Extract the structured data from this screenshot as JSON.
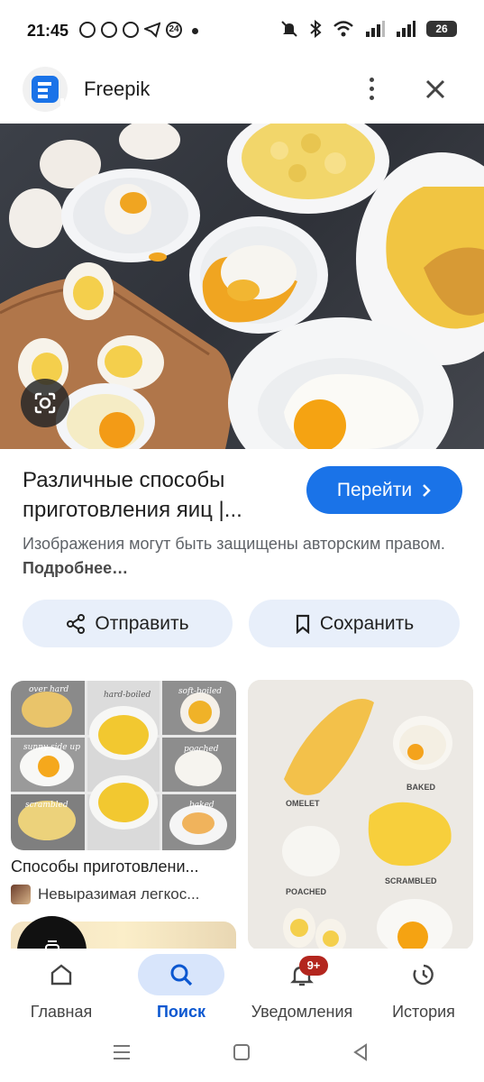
{
  "status_bar": {
    "time": "21:45",
    "notification_icons": [
      "viber-icon",
      "messages-icon",
      "whatsapp-icon",
      "telegram-icon",
      "24-icon"
    ],
    "battery": "26"
  },
  "header": {
    "site_name": "Freepik"
  },
  "result": {
    "title": "Различные способы приготовления яиц |...",
    "go_label": "Перейти",
    "notice_text": "Изображения могут быть защищены авторским правом.",
    "notice_link": "Подробнее…",
    "share_label": "Отправить",
    "save_label": "Сохранить"
  },
  "related": {
    "card_a": {
      "title": "Способы приготовлени...",
      "source": "Невыразимая легкос...",
      "labels": [
        "over hard",
        "hard-boiled",
        "soft-boiled",
        "sunny side up",
        "poached",
        "scrambled",
        "baked"
      ]
    },
    "card_b": {
      "labels": [
        "OMELET",
        "BAKED",
        "SCRAMBLED",
        "POACHED"
      ]
    }
  },
  "bottom_nav": {
    "items": [
      {
        "label": "Главная",
        "icon": "home-icon"
      },
      {
        "label": "Поиск",
        "icon": "search-icon"
      },
      {
        "label": "Уведомления",
        "icon": "bell-icon",
        "badge": "9+"
      },
      {
        "label": "История",
        "icon": "history-icon"
      }
    ],
    "active": "Поиск"
  },
  "colors": {
    "accent": "#1a73e8",
    "pill_bg": "#e8effa",
    "badge": "#b3261e"
  }
}
